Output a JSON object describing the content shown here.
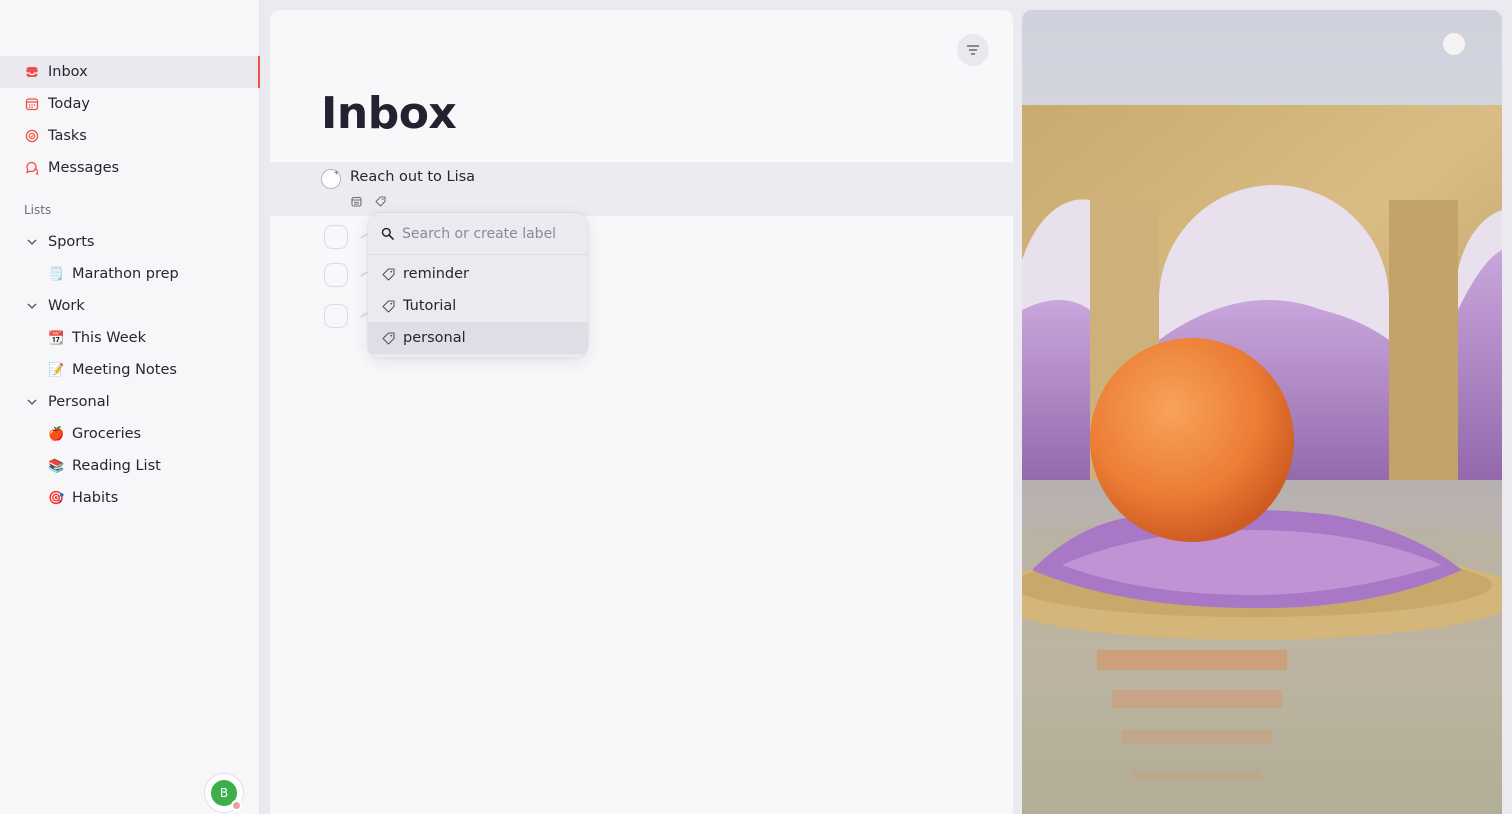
{
  "sidebar": {
    "nav": [
      {
        "label": "Inbox",
        "icon": "inbox-icon",
        "active": true
      },
      {
        "label": "Today",
        "icon": "calendar-icon"
      },
      {
        "label": "Tasks",
        "icon": "tasks-icon"
      },
      {
        "label": "Messages",
        "icon": "messages-icon"
      }
    ],
    "lists_label": "Lists",
    "groups": [
      {
        "label": "Sports",
        "items": [
          {
            "emoji": "🗒️",
            "label": "Marathon prep"
          }
        ]
      },
      {
        "label": "Work",
        "items": [
          {
            "emoji": "📆",
            "label": "This Week"
          },
          {
            "emoji": "📝",
            "label": "Meeting Notes"
          }
        ]
      },
      {
        "label": "Personal",
        "items": [
          {
            "emoji": "🍎",
            "label": "Groceries"
          },
          {
            "emoji": "📚",
            "label": "Reading List"
          },
          {
            "emoji": "🎯",
            "label": "Habits"
          }
        ]
      }
    ],
    "avatar_initial": "B"
  },
  "main": {
    "title": "Inbox",
    "task": {
      "text": "Reach out to Lisa"
    }
  },
  "label_menu": {
    "placeholder": "Search or create label",
    "options": [
      "reminder",
      "Tutorial",
      "personal"
    ],
    "highlighted": "personal"
  },
  "colors": {
    "accent": "#f0524a",
    "avatar": "#3bb04a",
    "sphere": "#f08a3c",
    "lavender": "#b58ad0"
  }
}
